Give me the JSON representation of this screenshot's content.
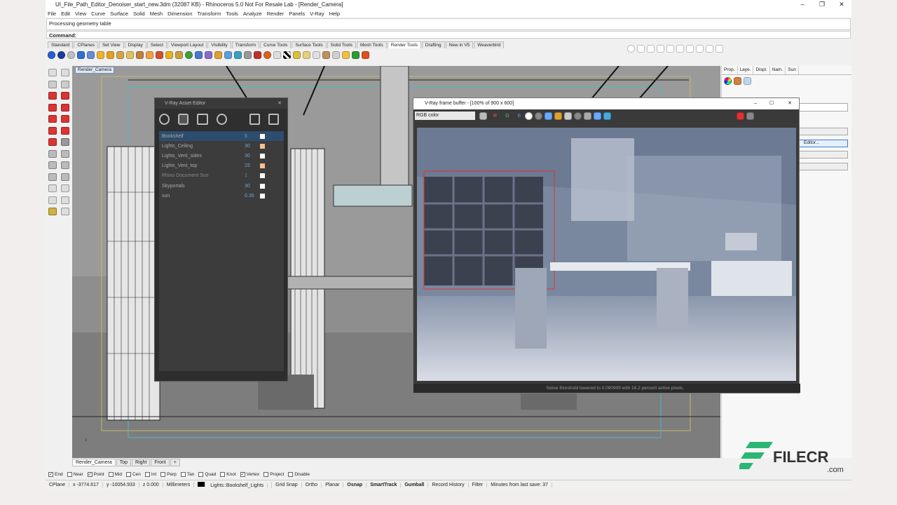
{
  "window": {
    "title": "UI_File_Path_Editor_Denoiser_start_new.3dm (32087 KB) - Rhinoceros 5.0 Not For Resale Lab - [Render_Camera]",
    "min": "–",
    "max": "❐",
    "close": "✕"
  },
  "menu": [
    "File",
    "Edit",
    "View",
    "Curve",
    "Surface",
    "Solid",
    "Mesh",
    "Dimension",
    "Transform",
    "Tools",
    "Analyze",
    "Render",
    "Panels",
    "V-Ray",
    "Help"
  ],
  "command": {
    "history": "Processing geometry table",
    "label": "Command:",
    "value": ""
  },
  "toolbar_tabs": [
    "Standard",
    "CPlanes",
    "Set View",
    "Display",
    "Select",
    "Viewport Layout",
    "Visibility",
    "Transform",
    "Curve Tools",
    "Surface Tools",
    "Solid Tools",
    "Mesh Tools",
    "Render Tools",
    "Drafting",
    "New in V5",
    "Weaverbird"
  ],
  "toolbar_tabs_selected": "Render Tools",
  "viewport": {
    "name": "Render_Camera"
  },
  "viewport_tabs": [
    "Render_Camera",
    "Top",
    "Right",
    "Front",
    "+"
  ],
  "right_panel": {
    "tabs": [
      "Prop.",
      "Laye.",
      "Displ.",
      "Nam.",
      "Sun"
    ],
    "editor_button": "Editor..."
  },
  "asset_editor": {
    "title": "V-Ray Asset Editor",
    "items": [
      {
        "name": "Bookshelf",
        "value": "5"
      },
      {
        "name": "Lights_Ceiling",
        "value": "30"
      },
      {
        "name": "Lights_Vent_sides",
        "value": "30"
      },
      {
        "name": "Lights_Vent_top",
        "value": "15"
      },
      {
        "name": "Rhino Document Sun",
        "value": "1"
      },
      {
        "name": "Skyportals",
        "value": "30"
      },
      {
        "name": "sun",
        "value": "0.35"
      }
    ]
  },
  "frame_buffer": {
    "title": "V-Ray frame buffer - [100% of 900 x 600]",
    "channel": "RGB color",
    "channel_buttons": [
      "R",
      "G",
      "B"
    ],
    "status": "Noise threshold lowered to 0.090909 with 16.2 percent active pixels."
  },
  "osnaps": [
    {
      "label": "End",
      "checked": true
    },
    {
      "label": "Near",
      "checked": false
    },
    {
      "label": "Point",
      "checked": true
    },
    {
      "label": "Mid",
      "checked": false
    },
    {
      "label": "Cen",
      "checked": false
    },
    {
      "label": "Int",
      "checked": false
    },
    {
      "label": "Perp",
      "checked": false
    },
    {
      "label": "Tan",
      "checked": false
    },
    {
      "label": "Quad",
      "checked": false
    },
    {
      "label": "Knot",
      "checked": false
    },
    {
      "label": "Vertex",
      "checked": true
    },
    {
      "label": "Project",
      "checked": false
    },
    {
      "label": "Disable",
      "checked": false
    }
  ],
  "status": {
    "cplane": "CPlane",
    "x": "x -3774.617",
    "y": "y -10054.933",
    "z": "z 0.000",
    "units": "Millimeters",
    "layer": "Lights::Bookshelf_Lights",
    "grid_snap": "Grid Snap",
    "ortho": "Ortho",
    "planar": "Planar",
    "osnap": "Osnap",
    "smarttrack": "SmartTrack",
    "gumball": "Gumball",
    "record": "Record History",
    "filter": "Filter",
    "save": "Minutes from last save: 37"
  },
  "watermark": {
    "brand": "FILECR",
    "domain": ".com",
    "color": "#2bb673"
  }
}
